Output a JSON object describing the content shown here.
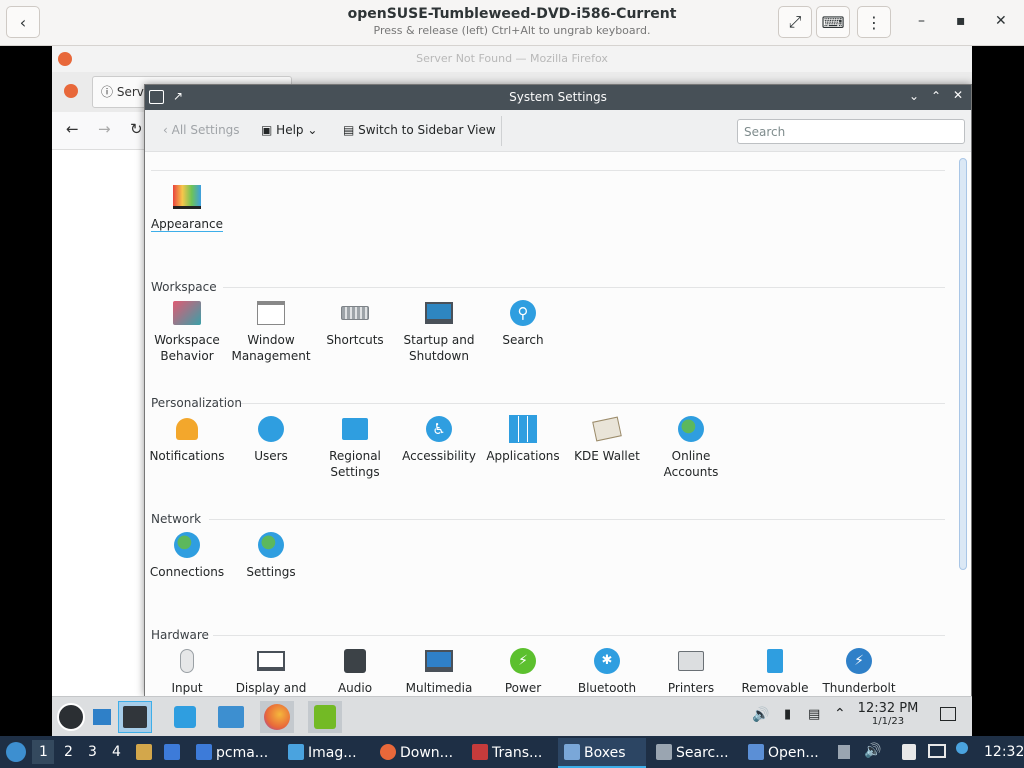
{
  "boxes": {
    "title": "openSUSE-Tumbleweed-DVD-i586-Current",
    "subtitle": "Press & release (left) Ctrl+Alt to ungrab keyboard."
  },
  "firefox": {
    "window_title": "Server Not Found — Mozilla Firefox",
    "tab_label": "Serv"
  },
  "settings": {
    "title": "System Settings",
    "toolbar": {
      "back_label": "All Settings",
      "help_label": "Help",
      "sidebar_label": "Switch to Sidebar View",
      "search_placeholder": "Search"
    },
    "appearance": {
      "label": "Appearance"
    },
    "workspace": {
      "header": "Workspace",
      "items": [
        {
          "l1": "Workspace",
          "l2": "Behavior"
        },
        {
          "l1": "Window",
          "l2": "Management"
        },
        {
          "l1": "Shortcuts",
          "l2": ""
        },
        {
          "l1": "Startup and",
          "l2": "Shutdown"
        },
        {
          "l1": "Search",
          "l2": ""
        }
      ]
    },
    "personalization": {
      "header": "Personalization",
      "items": [
        {
          "l1": "Notifications",
          "l2": ""
        },
        {
          "l1": "Users",
          "l2": ""
        },
        {
          "l1": "Regional",
          "l2": "Settings"
        },
        {
          "l1": "Accessibility",
          "l2": ""
        },
        {
          "l1": "Applications",
          "l2": ""
        },
        {
          "l1": "KDE Wallet",
          "l2": ""
        },
        {
          "l1": "Online",
          "l2": "Accounts"
        }
      ]
    },
    "network": {
      "header": "Network",
      "items": [
        {
          "l1": "Connections",
          "l2": ""
        },
        {
          "l1": "Settings",
          "l2": ""
        }
      ]
    },
    "hardware": {
      "header": "Hardware",
      "items": [
        {
          "l1": "Input"
        },
        {
          "l1": "Display and"
        },
        {
          "l1": "Audio"
        },
        {
          "l1": "Multimedia"
        },
        {
          "l1": "Power"
        },
        {
          "l1": "Bluetooth"
        },
        {
          "l1": "Printers"
        },
        {
          "l1": "Removable"
        },
        {
          "l1": "Thunderbolt"
        }
      ]
    }
  },
  "vm_panel": {
    "clock_time": "12:32 PM",
    "clock_date": "1/1/23"
  },
  "host_taskbar": {
    "workspaces": [
      "1",
      "2",
      "3",
      "4"
    ],
    "tasks": [
      {
        "label": "pcma...",
        "color": "#3d7bd9"
      },
      {
        "label": "Imag...",
        "color": "#4aa3df"
      },
      {
        "label": "Down...",
        "color": "#e8683a"
      },
      {
        "label": "Trans...",
        "color": "#c63b3b"
      },
      {
        "label": "Boxes",
        "color": "#7aa7d8"
      },
      {
        "label": "Searc...",
        "color": "#9aa5b1"
      },
      {
        "label": "Open...",
        "color": "#5b8fd6"
      }
    ],
    "clock": "12:32"
  }
}
